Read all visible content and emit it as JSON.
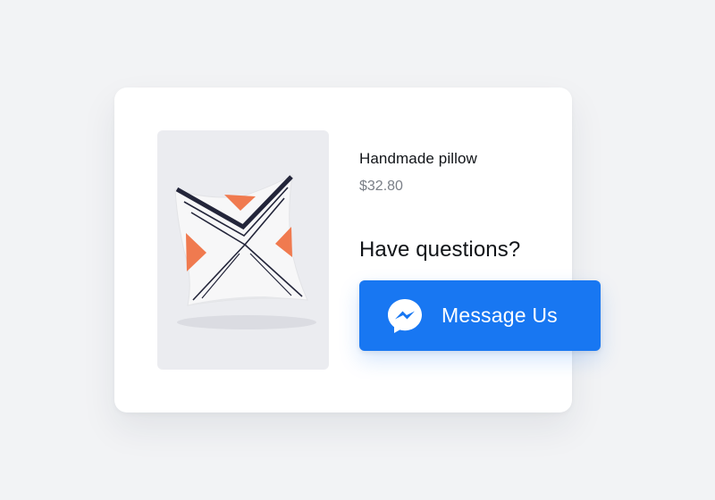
{
  "product": {
    "image_icon": "pillow-image",
    "name": "Handmade pillow",
    "price": "$32.80"
  },
  "prompt": {
    "question": "Have questions?"
  },
  "cta": {
    "label": "Message Us",
    "icon": "messenger-icon",
    "color": "#1877f2"
  },
  "colors": {
    "background": "#f2f3f5",
    "card": "#ffffff",
    "image_bg": "#ebecf0",
    "pillow_orange": "#f07a4f",
    "pillow_navy": "#23253a"
  }
}
